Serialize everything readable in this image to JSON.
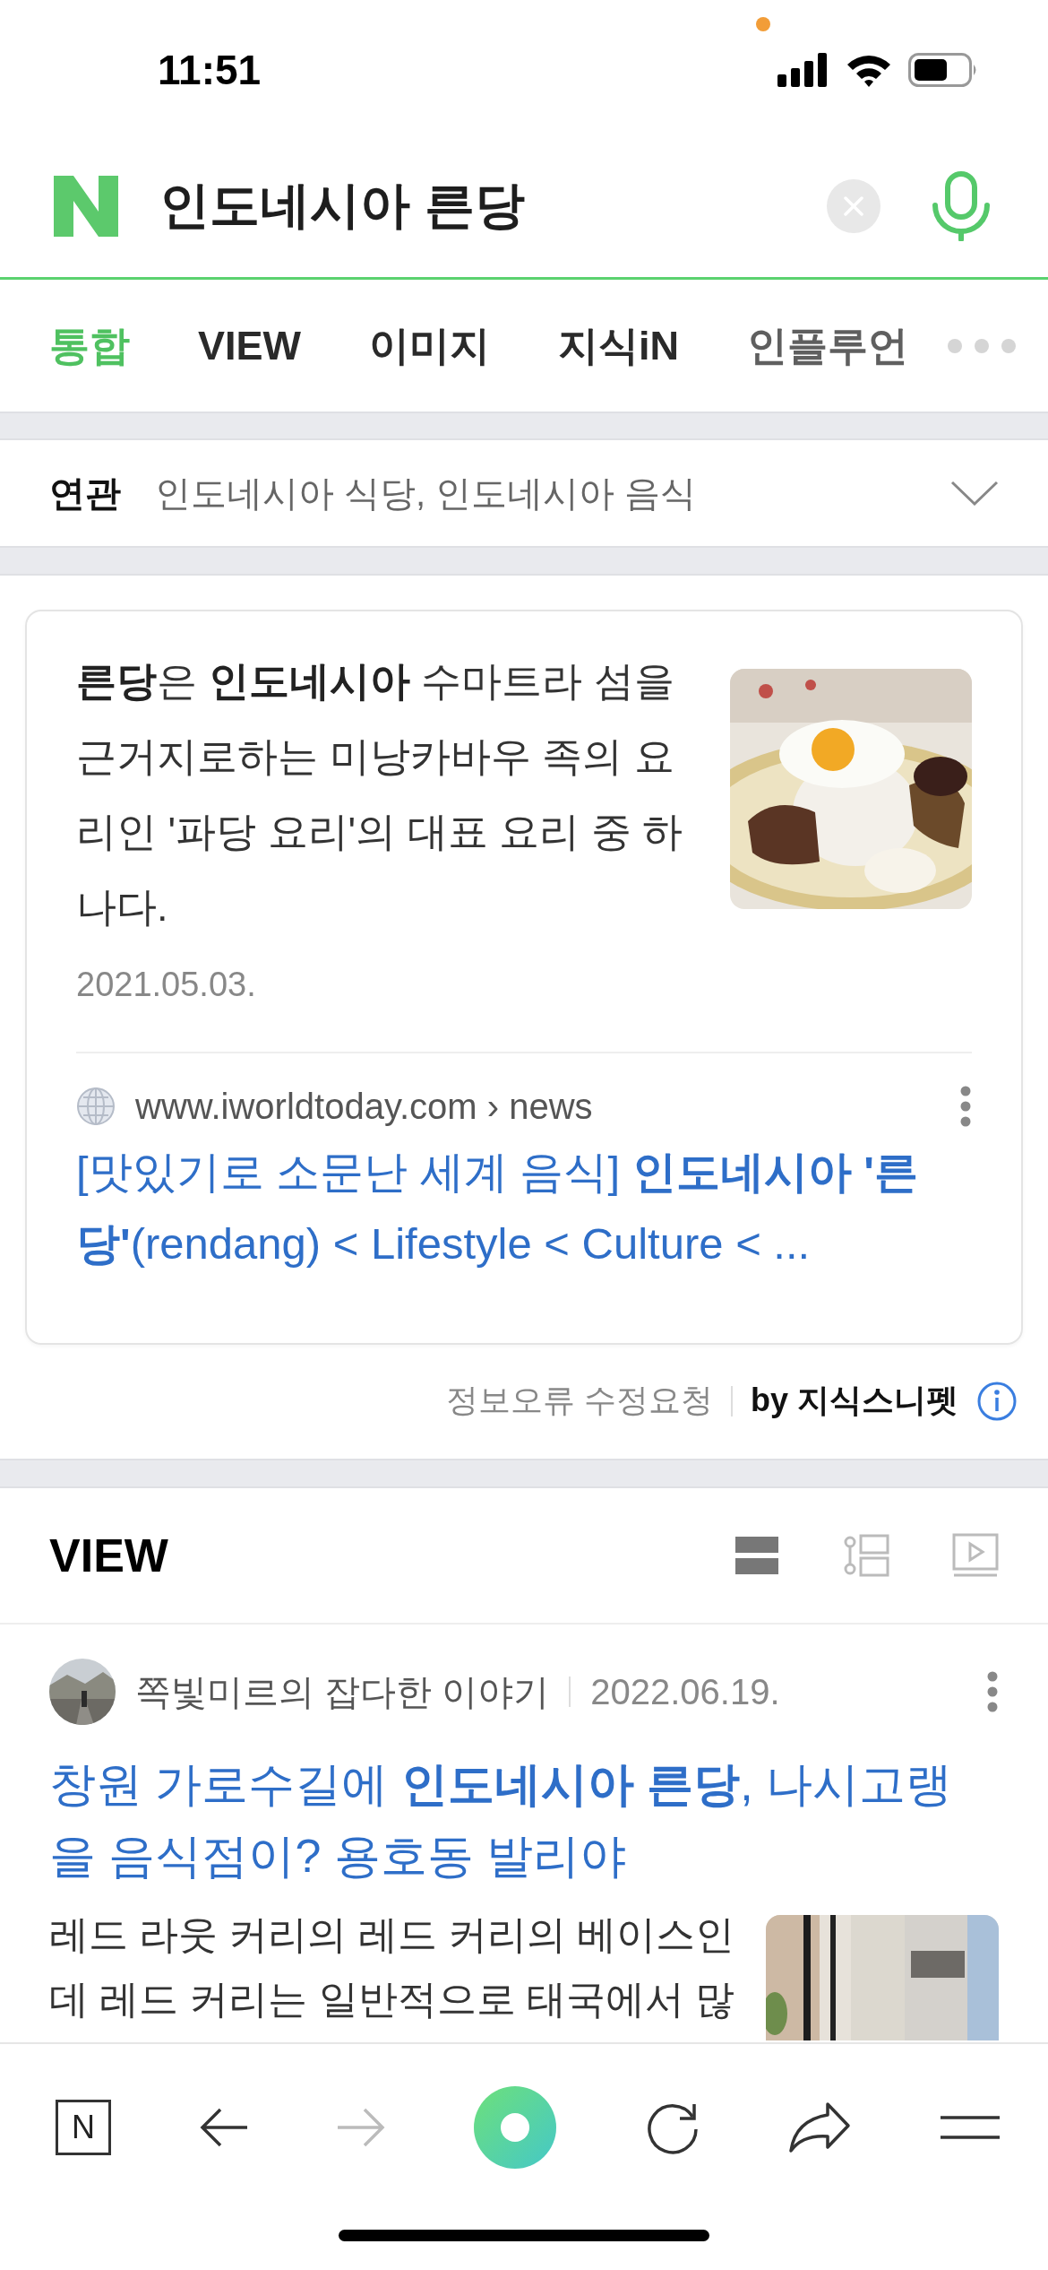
{
  "status_bar": {
    "time": "11:51"
  },
  "search": {
    "query": "인도네시아 른당"
  },
  "tabs": [
    {
      "label": "통합",
      "selected": true
    },
    {
      "label": "VIEW",
      "selected": false
    },
    {
      "label": "이미지",
      "selected": false
    },
    {
      "label": "지식iN",
      "selected": false
    },
    {
      "label": "인플루언",
      "selected": false
    }
  ],
  "related": {
    "label": "연관",
    "text": "인도네시아 식당, 인도네시아 음식"
  },
  "snippet": {
    "description": "**른당**은 **인도네시아** 수마트라 섬을 근거지로하는 미낭카바우 족의 요리인 '파당 요리'의 대표 요리 중 하나다.",
    "date": "2021.05.03.",
    "source": "www.iworldtoday.com › news",
    "title": "[맛있기로 소문난 세계 음식] **인도네시아 '른당'**(rendang) < Lifestyle < Culture < ..."
  },
  "snippet_footer": {
    "report": "정보오류 수정요청",
    "credit": "by 지식스니펫"
  },
  "view": {
    "title": "VIEW",
    "layouts": [
      {
        "kind": "list",
        "selected": true
      },
      {
        "kind": "timeline",
        "selected": false
      },
      {
        "kind": "video",
        "selected": false
      }
    ],
    "posts": [
      {
        "author": "쪽빛미르의 잡다한 이야기",
        "date": "2022.06.19.",
        "title": "창원 가로수길에 **인도네시아 른당**, 나시고랭을 음식점이? 용호동 발리야",
        "summary": "레드 라웃 커리의 레드 커리의 베이스인데 레드 커리는 일반적으로 태국에서 많"
      }
    ]
  },
  "toolbar": [
    {
      "kind": "home",
      "label": "N"
    },
    {
      "kind": "back",
      "disabled": false
    },
    {
      "kind": "forward",
      "disabled": true
    },
    {
      "kind": "green-button"
    },
    {
      "kind": "reload"
    },
    {
      "kind": "share"
    },
    {
      "kind": "menu"
    }
  ]
}
